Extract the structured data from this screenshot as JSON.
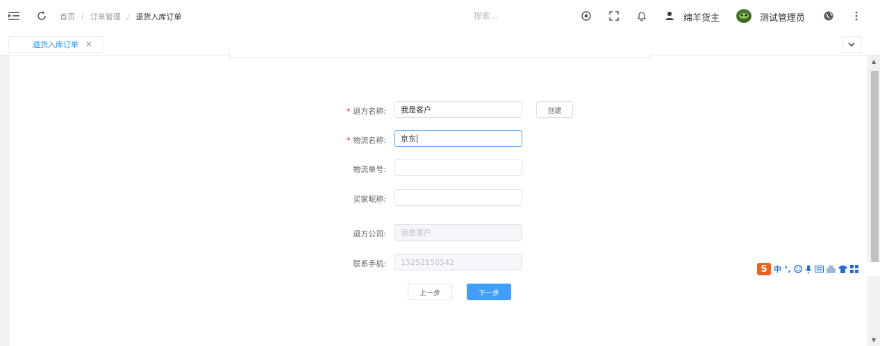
{
  "header": {
    "breadcrumb": [
      "首页",
      "订单管理",
      "退货入库订单"
    ],
    "search_placeholder": "搜索...",
    "user_name": "绵羊货主",
    "admin_name": "测试管理员"
  },
  "tags": {
    "active_tag": "退货入库订单",
    "close_glyph": "✕"
  },
  "form": {
    "returner_name_label": "退方名称:",
    "returner_name_value": "我是客户",
    "create_button": "创建",
    "logistics_name_label": "物流名称:",
    "logistics_name_value": "京东",
    "tracking_number_label": "物流单号:",
    "tracking_number_value": "",
    "buyer_nickname_label": "买家昵称:",
    "buyer_nickname_value": "",
    "return_company_label": "退方公司:",
    "return_company_value": "我是客户",
    "contact_phone_label": "联系手机:",
    "contact_phone_value": "15252150542",
    "prev_button": "上一步",
    "next_button": "下一步"
  },
  "ime": {
    "logo": "S",
    "mode": "中",
    "punct": "°,"
  },
  "colors": {
    "primary": "#409eff",
    "tag_active": "#1890ff",
    "required": "#f5222d"
  }
}
